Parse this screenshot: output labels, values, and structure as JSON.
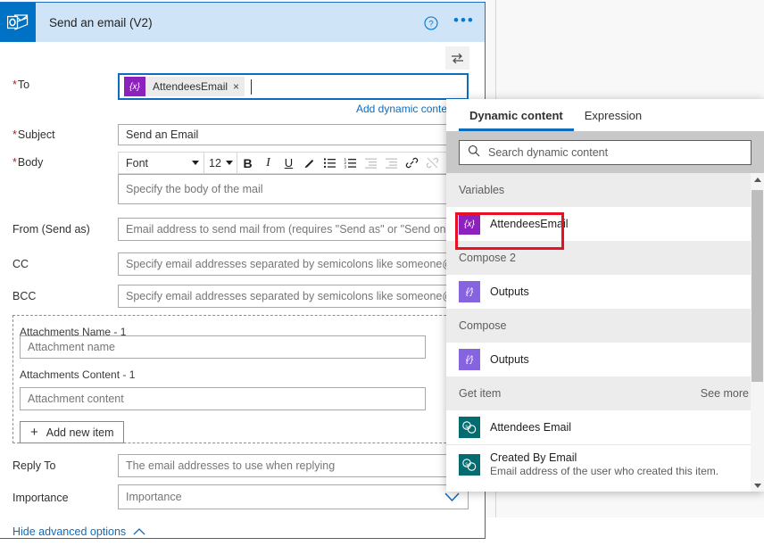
{
  "card": {
    "icon_name": "outlook-icon",
    "title": "Send an email (V2)",
    "help_icon": "help-circle-icon",
    "more_icon": "ellipsis-icon",
    "swap_icon": "swap-inputs-icon",
    "add_dynamic_content_link": "Add dynamic content",
    "hide_advanced_options": "Hide advanced options"
  },
  "fields": {
    "to": {
      "label": "To",
      "required": true,
      "token_chip": "{x}",
      "token_text": "AttendeesEmail",
      "token_remove": "×"
    },
    "subject": {
      "label": "Subject",
      "required": true,
      "value": "Send an Email"
    },
    "body": {
      "label": "Body",
      "required": true,
      "placeholder": "Specify the body of the mail"
    },
    "from": {
      "label": "From (Send as)",
      "required": false,
      "placeholder": "Email address to send mail from (requires \"Send as\" or \"Send on behalf of\" permissions for that mailbox). For more info on granting permissions please refer to"
    },
    "cc": {
      "label": "CC",
      "required": false,
      "placeholder": "Specify email addresses separated by semicolons like someone@contoso.com"
    },
    "bcc": {
      "label": "BCC",
      "required": false,
      "placeholder": "Specify email addresses separated by semicolons like someone@contoso.com"
    },
    "attachments_name": {
      "label": "Attachments Name - 1",
      "placeholder": "Attachment name"
    },
    "attachments_content": {
      "label": "Attachments Content - 1",
      "placeholder": "Attachment content"
    },
    "add_new_item": "Add new item",
    "reply_to": {
      "label": "Reply To",
      "required": false,
      "placeholder": "The email addresses to use when replying"
    },
    "importance": {
      "label": "Importance",
      "required": false,
      "placeholder": "Importance"
    }
  },
  "rte_toolbar": {
    "font_name": "Font",
    "font_size": "12",
    "buttons": [
      {
        "name": "bold-icon",
        "glyph": "B",
        "disabled": false
      },
      {
        "name": "italic-icon",
        "glyph": "I",
        "disabled": false
      },
      {
        "name": "underline-icon",
        "glyph": "U",
        "disabled": false
      },
      {
        "name": "text-highlight-icon",
        "glyph": "✐",
        "disabled": false
      },
      {
        "name": "bulleted-list-icon",
        "glyph": "☰",
        "disabled": false
      },
      {
        "name": "numbered-list-icon",
        "glyph": "≡",
        "disabled": false
      },
      {
        "name": "decrease-indent-icon",
        "glyph": "☲",
        "disabled": true
      },
      {
        "name": "increase-indent-icon",
        "glyph": "☲",
        "disabled": true
      },
      {
        "name": "insert-link-icon",
        "glyph": "🔗",
        "disabled": false
      },
      {
        "name": "remove-link-icon",
        "glyph": "🔗",
        "disabled": true
      },
      {
        "name": "code-view-icon",
        "glyph": "‹",
        "disabled": false
      }
    ]
  },
  "dynamic_content": {
    "tabs": [
      {
        "label": "Dynamic content",
        "active": true
      },
      {
        "label": "Expression",
        "active": false
      }
    ],
    "search_placeholder": "Search dynamic content",
    "search_icon": "search-icon",
    "sections": [
      {
        "title": "Variables",
        "see_more": "",
        "items": [
          {
            "name": "AttendeesEmail",
            "sub": "",
            "icon": "variable-icon",
            "icon_style": "ico-var",
            "glyph": "{x}",
            "highlighted": true
          }
        ]
      },
      {
        "title": "Compose 2",
        "see_more": "",
        "items": [
          {
            "name": "Outputs",
            "sub": "",
            "icon": "compose-output-icon",
            "icon_style": "ico-out",
            "glyph": "{⁄}",
            "highlighted": false
          }
        ]
      },
      {
        "title": "Compose",
        "see_more": "",
        "items": [
          {
            "name": "Outputs",
            "sub": "",
            "icon": "compose-output-icon",
            "icon_style": "ico-out",
            "glyph": "{⁄}",
            "highlighted": false
          }
        ]
      },
      {
        "title": "Get item",
        "see_more": "See more",
        "items": [
          {
            "name": "Attendees Email",
            "sub": "",
            "icon": "sharepoint-icon",
            "icon_style": "ico-sp",
            "glyph": "s",
            "highlighted": false
          },
          {
            "name": "Created By Email",
            "sub": "Email address of the user who created this item.",
            "icon": "sharepoint-icon",
            "icon_style": "ico-sp",
            "glyph": "s",
            "highlighted": false
          }
        ]
      }
    ],
    "scrollbar": {
      "up_icon": "scroll-up-arrow",
      "down_icon": "scroll-down-arrow"
    }
  },
  "annotation": {
    "type": "red-rectangle",
    "color": "#e81123",
    "target": "AttendeesEmail"
  },
  "colors": {
    "accent": "#0f6cbd",
    "outlook_blue": "#0072c6",
    "header_band": "#cfe4f7",
    "variable_purple": "#8c21bd",
    "output_purple": "#8764df",
    "sharepoint_teal": "#036c70",
    "required_red": "#a4262c",
    "annotation_red": "#e81123"
  }
}
